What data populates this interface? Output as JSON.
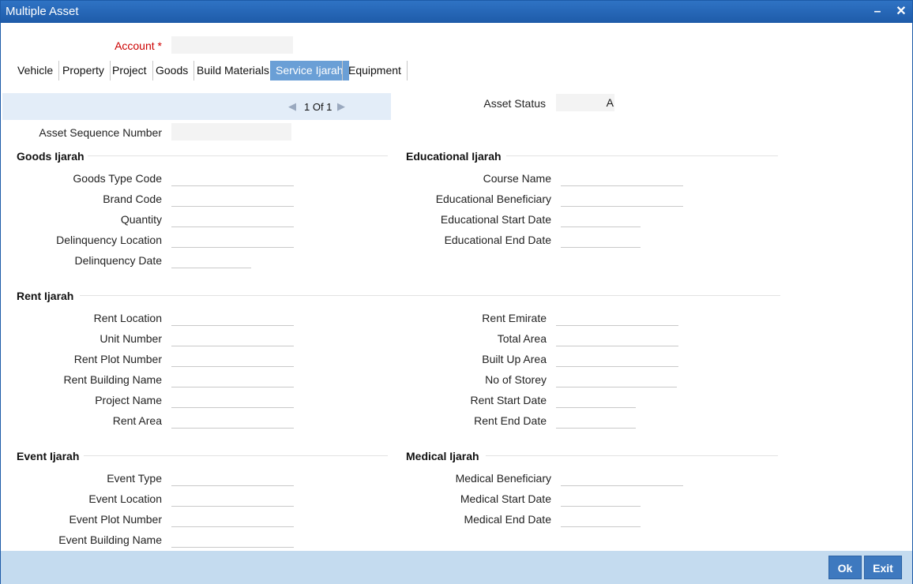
{
  "window": {
    "title": "Multiple Asset"
  },
  "account": {
    "label": "Account",
    "required_marker": "*",
    "value": ""
  },
  "tabs": [
    {
      "label": "Vehicle"
    },
    {
      "label": "Property"
    },
    {
      "label": "Project"
    },
    {
      "label": "Goods"
    },
    {
      "label": "Build Materials"
    },
    {
      "label": "Service Ijarah",
      "active": true
    },
    {
      "label": "Equipment"
    }
  ],
  "navigator": {
    "page_text": "1 Of 1"
  },
  "asset_status": {
    "label": "Asset Status",
    "value": "A"
  },
  "asset_sequence": {
    "label": "Asset Sequence Number",
    "value": ""
  },
  "goods_ijarah": {
    "title": "Goods Ijarah",
    "fields": [
      {
        "label": "Goods Type Code",
        "value": ""
      },
      {
        "label": "Brand Code",
        "value": ""
      },
      {
        "label": "Quantity",
        "value": ""
      },
      {
        "label": "Delinquency Location",
        "value": ""
      },
      {
        "label": "Delinquency Date",
        "value": ""
      }
    ]
  },
  "educational_ijarah": {
    "title": "Educational Ijarah",
    "fields": [
      {
        "label": "Course Name",
        "value": ""
      },
      {
        "label": "Educational Beneficiary",
        "value": ""
      },
      {
        "label": "Educational Start Date",
        "value": ""
      },
      {
        "label": "Educational End Date",
        "value": ""
      }
    ]
  },
  "rent_ijarah": {
    "title": "Rent Ijarah",
    "left_fields": [
      {
        "label": "Rent Location",
        "value": ""
      },
      {
        "label": "Unit Number",
        "value": ""
      },
      {
        "label": "Rent Plot Number",
        "value": ""
      },
      {
        "label": "Rent Building Name",
        "value": ""
      },
      {
        "label": "Project Name",
        "value": ""
      },
      {
        "label": "Rent Area",
        "value": ""
      }
    ],
    "right_fields": [
      {
        "label": "Rent Emirate",
        "value": ""
      },
      {
        "label": "Total Area",
        "value": ""
      },
      {
        "label": "Built Up Area",
        "value": ""
      },
      {
        "label": "No of Storey",
        "value": ""
      },
      {
        "label": "Rent Start Date",
        "value": ""
      },
      {
        "label": "Rent End Date",
        "value": ""
      }
    ]
  },
  "event_ijarah": {
    "title": "Event Ijarah",
    "fields": [
      {
        "label": "Event Type",
        "value": ""
      },
      {
        "label": "Event Location",
        "value": ""
      },
      {
        "label": "Event Plot Number",
        "value": ""
      },
      {
        "label": "Event Building Name",
        "value": ""
      }
    ]
  },
  "medical_ijarah": {
    "title": "Medical Ijarah",
    "fields": [
      {
        "label": "Medical Beneficiary",
        "value": ""
      },
      {
        "label": "Medical Start Date",
        "value": ""
      },
      {
        "label": "Medical End Date",
        "value": ""
      }
    ]
  },
  "footer": {
    "ok_label": "Ok",
    "exit_label": "Exit"
  },
  "icons": {
    "minimize": "minimize-icon",
    "close": "close-icon",
    "prev": "prev-arrow-icon",
    "next": "next-arrow-icon"
  }
}
